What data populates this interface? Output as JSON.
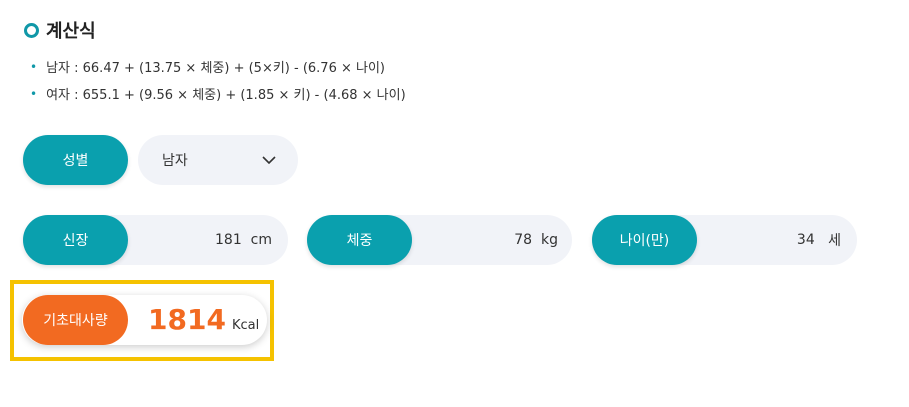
{
  "section": {
    "title": "계산식",
    "formulas": [
      "남자 : 66.47 + (13.75 × 체중) + (5×키) - (6.76 × 나이)",
      "여자 : 655.1 + (9.56 × 체중) + (1.85 × 키) - (4.68 × 나이)"
    ]
  },
  "gender": {
    "label": "성별",
    "selected": "남자"
  },
  "height": {
    "label": "신장",
    "value": "181",
    "unit": "cm"
  },
  "weight": {
    "label": "체중",
    "value": "78",
    "unit": "kg"
  },
  "age": {
    "label": "나이(만)",
    "value": "34",
    "unit": "세"
  },
  "result": {
    "label": "기초대사량",
    "value": "1814",
    "unit": "Kcal"
  },
  "colors": {
    "teal": "#0aa0ae",
    "orange": "#f26a21",
    "highlight": "#f5c200",
    "field_bg": "#f1f3f8"
  }
}
